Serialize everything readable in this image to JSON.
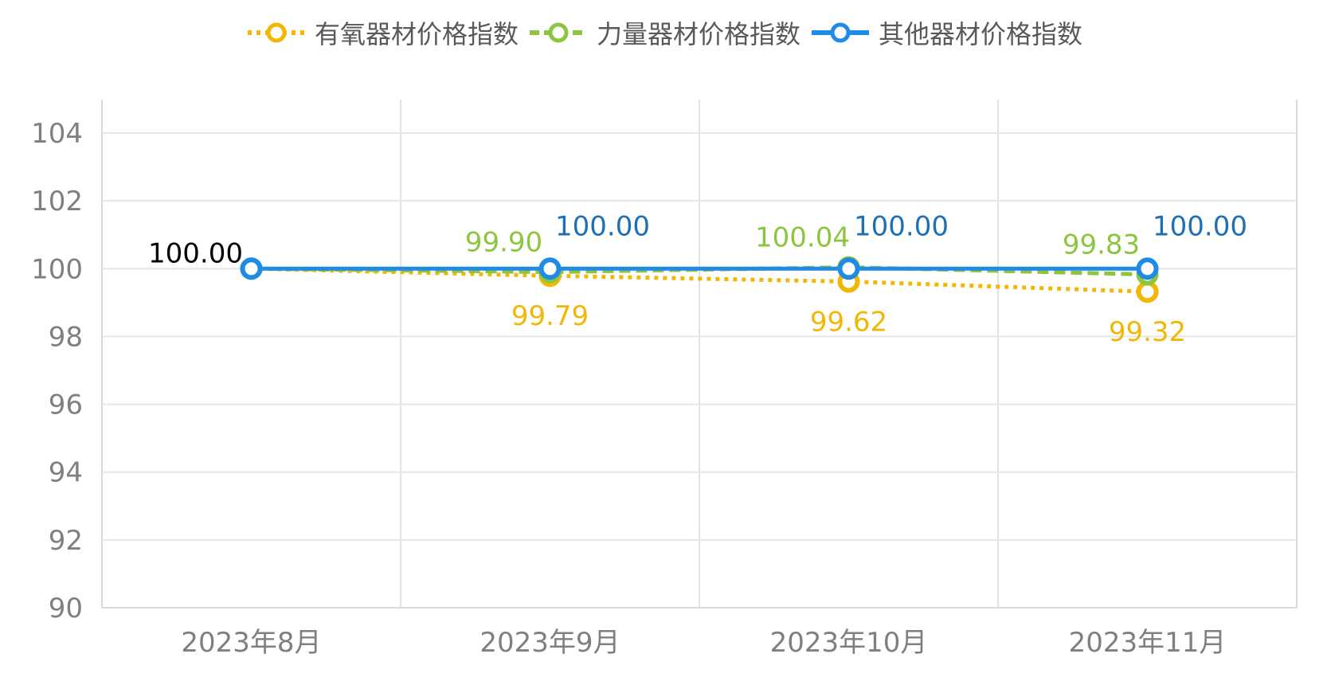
{
  "chart_data": {
    "type": "line",
    "categories": [
      "2023年8月",
      "2023年9月",
      "2023年10月",
      "2023年11月"
    ],
    "ylim": [
      90,
      104
    ],
    "yticks": [
      "90",
      "92",
      "94",
      "96",
      "98",
      "100",
      "102",
      "104"
    ],
    "grid": true,
    "legend_position": "top",
    "series": [
      {
        "name": "有氧器材价格指数",
        "values": [
          100.0,
          99.79,
          99.62,
          99.32
        ],
        "labels": [
          "",
          "99.79",
          "99.62",
          "99.32"
        ],
        "color": "#F2B705",
        "dash": "dotted"
      },
      {
        "name": "力量器材价格指数",
        "values": [
          100.0,
          99.9,
          100.04,
          99.83
        ],
        "labels": [
          "",
          "99.90",
          "100.04",
          "99.83"
        ],
        "color": "#8CC63F",
        "dash": "dashed"
      },
      {
        "name": "其他器材价格指数",
        "values": [
          100.0,
          100.0,
          100.0,
          100.0
        ],
        "labels": [
          "100.00",
          "100.00",
          "100.00",
          "100.00"
        ],
        "color": "#1F8BE6",
        "label_colors": [
          "#000000",
          "#1F6FB5",
          "#1F6FB5",
          "#1F6FB5"
        ],
        "dash": "solid"
      }
    ]
  }
}
